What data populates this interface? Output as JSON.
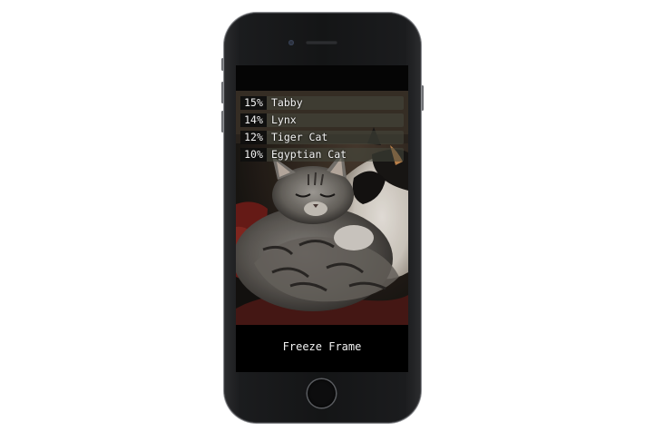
{
  "device": {
    "icons": {
      "camera": "front-camera-icon",
      "speaker": "earpiece-speaker-icon",
      "home": "home-button-icon"
    },
    "colors": {
      "body": "#141516",
      "screen": "#000000",
      "text": "#f4f4f4"
    }
  },
  "predictions": [
    {
      "percent": "15%",
      "label": "Tabby"
    },
    {
      "percent": "14%",
      "label": "Lynx"
    },
    {
      "percent": "12%",
      "label": "Tiger Cat"
    },
    {
      "percent": "10%",
      "label": "Egyptian Cat"
    }
  ],
  "controls": {
    "freeze_label": "Freeze Frame"
  }
}
